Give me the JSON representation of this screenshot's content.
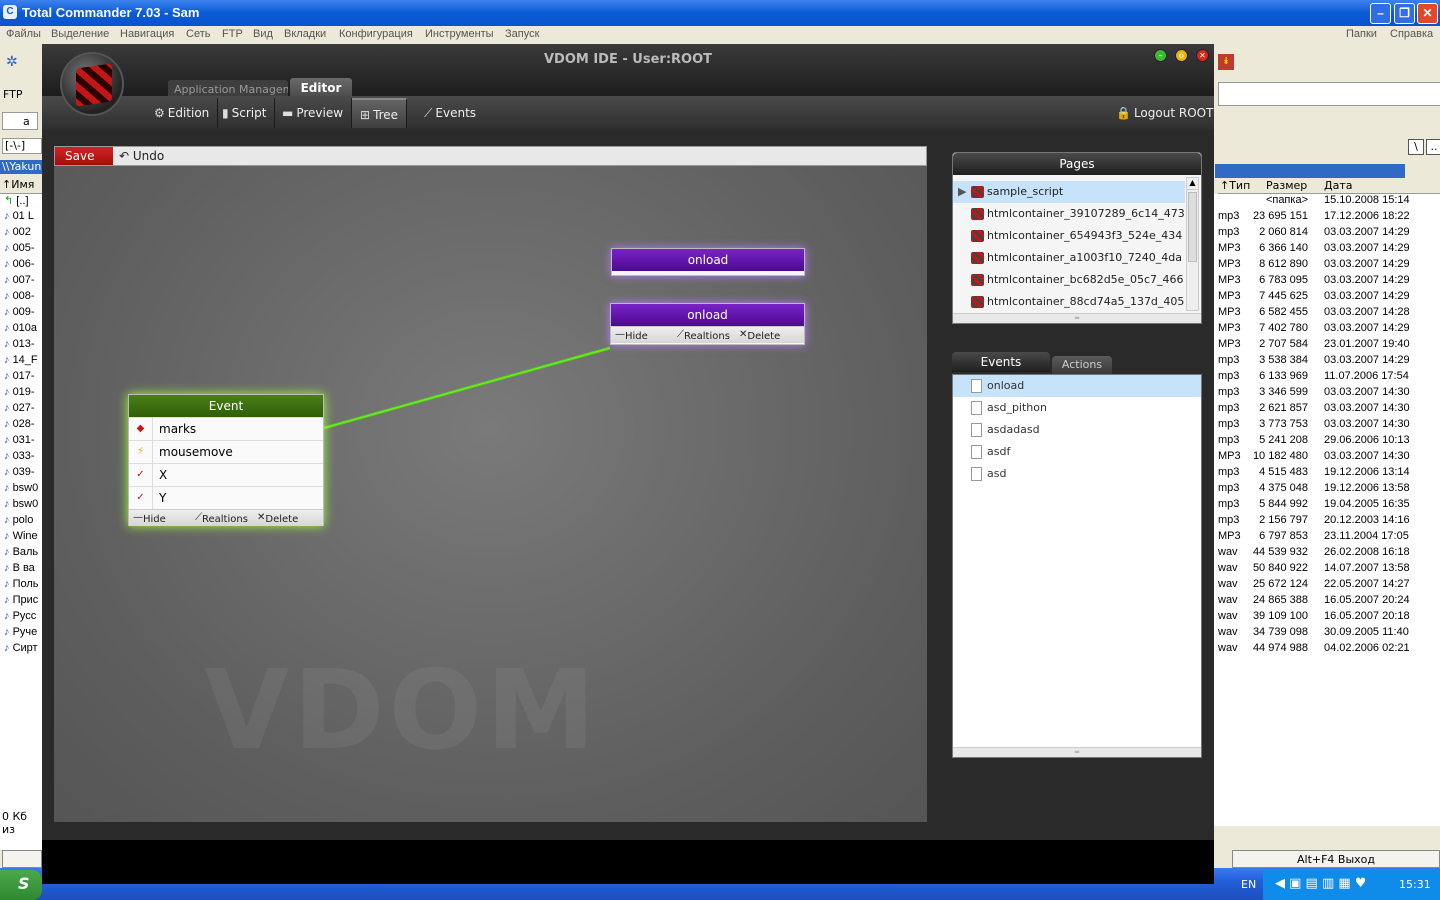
{
  "tc": {
    "title": "Total Commander 7.03 - Sam",
    "menu": [
      "Файлы",
      "Выделение",
      "Навигация",
      "Сеть",
      "FTP",
      "Вид",
      "Вкладки",
      "Конфигурация",
      "Инструменты",
      "Запуск"
    ],
    "menu_right": [
      "Папки",
      "Справка"
    ],
    "ftp_label": "FTP",
    "drive_label": "a",
    "path_combo": "[-\\-]",
    "left_path": "\\\\Yakuni",
    "left_header": "↑Имя",
    "left_files": [
      "[..]",
      "01 L",
      "002",
      "005-",
      "006-",
      "007-",
      "008-",
      "009-",
      "010a",
      "013-",
      "14_F",
      "017-",
      "019-",
      "027-",
      "028-",
      "031-",
      "033-",
      "039-",
      "bsw0",
      "bsw0",
      "polo",
      "Wine",
      "Валь",
      "В ва",
      "Поль",
      "Прис",
      "Русс",
      "Руче",
      "Сирт"
    ],
    "right_headers": [
      "↑Тип",
      "Размер",
      "Дата"
    ],
    "right_files": [
      {
        "type": "",
        "size": "<папка>",
        "date": "15.10.2008 15:14"
      },
      {
        "type": "mp3",
        "size": "23 695 151",
        "date": "17.12.2006 18:22"
      },
      {
        "type": "mp3",
        "size": "2 060 814",
        "date": "03.03.2007 14:29"
      },
      {
        "type": "MP3",
        "size": "6 366 140",
        "date": "03.03.2007 14:29"
      },
      {
        "type": "MP3",
        "size": "8 612 890",
        "date": "03.03.2007 14:29"
      },
      {
        "type": "MP3",
        "size": "6 783 095",
        "date": "03.03.2007 14:29"
      },
      {
        "type": "MP3",
        "size": "7 445 625",
        "date": "03.03.2007 14:29"
      },
      {
        "type": "MP3",
        "size": "6 582 455",
        "date": "03.03.2007 14:28"
      },
      {
        "type": "MP3",
        "size": "7 402 780",
        "date": "03.03.2007 14:29"
      },
      {
        "type": "MP3",
        "size": "2 707 584",
        "date": "23.01.2007 19:40"
      },
      {
        "type": "mp3",
        "size": "3 538 384",
        "date": "03.03.2007 14:29"
      },
      {
        "type": "mp3",
        "size": "6 133 969",
        "date": "11.07.2006 17:54"
      },
      {
        "type": "mp3",
        "size": "3 346 599",
        "date": "03.03.2007 14:30"
      },
      {
        "type": "mp3",
        "size": "2 621 857",
        "date": "03.03.2007 14:30"
      },
      {
        "type": "mp3",
        "size": "3 773 753",
        "date": "03.03.2007 14:30"
      },
      {
        "type": "mp3",
        "size": "5 241 208",
        "date": "29.06.2006 10:13"
      },
      {
        "type": "MP3",
        "size": "10 182 480",
        "date": "03.03.2007 14:30"
      },
      {
        "type": "mp3",
        "size": "4 515 483",
        "date": "19.12.2006 13:14"
      },
      {
        "type": "mp3",
        "size": "4 375 048",
        "date": "19.12.2006 13:58"
      },
      {
        "type": "mp3",
        "size": "5 844 992",
        "date": "19.04.2005 16:35"
      },
      {
        "type": "mp3",
        "size": "2 156 797",
        "date": "20.12.2003 14:16"
      },
      {
        "type": "MP3",
        "size": "6 797 853",
        "date": "23.11.2004 17:05"
      },
      {
        "type": "wav",
        "size": "44 539 932",
        "date": "26.02.2008 16:18"
      },
      {
        "type": "wav",
        "size": "50 840 922",
        "date": "14.07.2007 13:58"
      },
      {
        "type": "wav",
        "size": "25 672 124",
        "date": "22.05.2007 14:27"
      },
      {
        "type": "wav",
        "size": "24 865 388",
        "date": "16.05.2007 20:24"
      },
      {
        "type": "wav",
        "size": "39 109 100",
        "date": "16.05.2007 20:18"
      },
      {
        "type": "wav",
        "size": "34 739 098",
        "date": "30.09.2005 11:40"
      },
      {
        "type": "wav",
        "size": "44 974 988",
        "date": "04.02.2006 02:21"
      }
    ],
    "status_left": "0 Кб из",
    "exit_button": "Alt+F4 Выход",
    "lang": "EN",
    "clock": "15:31",
    "start": "S"
  },
  "vdom": {
    "title": "VDOM IDE - User:ROOT",
    "top_tabs": {
      "app_mgmt": "Application Managem",
      "editor": "Editor"
    },
    "toolbar": {
      "edition": "Edition",
      "script": "Script",
      "preview": "Preview",
      "tree": "Tree",
      "events": "Events",
      "logout": "Logout ROOT"
    },
    "save": "Save",
    "undo": "Undo",
    "watermark": "VDOM",
    "nodes": {
      "onload1": {
        "title": "onload"
      },
      "onload2": {
        "title": "onload",
        "hide": "Hide",
        "relations": "Realtions",
        "delete": "Delete"
      },
      "event": {
        "title": "Event",
        "rows": [
          "marks",
          "mousemove",
          "X",
          "Y"
        ],
        "hide": "Hide",
        "relations": "Realtions",
        "delete": "Delete"
      }
    },
    "pages": {
      "title": "Pages",
      "items": [
        "sample_script",
        "htmlcontainer_39107289_6c14_473",
        "htmlcontainer_654943f3_524e_434",
        "htmlcontainer_a1003f10_7240_4da",
        "htmlcontainer_bc682d5e_05c7_466",
        "htmlcontainer_88cd74a5_137d_405"
      ]
    },
    "events_panel": {
      "tab_events": "Events",
      "tab_actions": "Actions",
      "items": [
        "onload",
        "asd_pithon",
        "asdadasd",
        "asdf",
        "asd"
      ]
    }
  }
}
